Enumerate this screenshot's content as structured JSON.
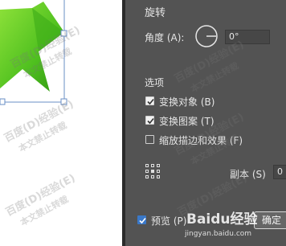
{
  "panel": {
    "rotate_section": "旋转",
    "angle_label": "角度 (A):",
    "angle_value": "0°",
    "options_section": "选项",
    "transform_objects_label": "变换对象 (B)",
    "transform_objects_checked": true,
    "transform_patterns_label": "变换图案 (T)",
    "transform_patterns_checked": true,
    "scale_strokes_label": "缩放描边和效果 (F)",
    "scale_strokes_checked": false,
    "copy_label": "副本 (S)",
    "copy_value": "0",
    "preview_label": "预览 (P)",
    "preview_checked": true,
    "ok_label": "确定"
  },
  "watermark": {
    "lines": [
      "百度(D)经验(E)",
      "本文禁止转载"
    ],
    "brand": "Baidu经验",
    "url": "jingyan.baidu.com"
  },
  "colors": {
    "panel_bg": "#535353",
    "star_light": "#7ddc2f",
    "star_dark": "#2f9a10",
    "selection": "#6a8fc6",
    "checkbox_accent": "#3a78c8"
  },
  "icons": {
    "angle_dial": "angle-dial-icon",
    "reference_point": "reference-point-grid-icon",
    "checkmark": "checkmark-icon"
  }
}
